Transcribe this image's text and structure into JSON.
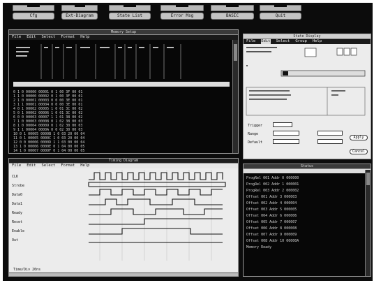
{
  "top_buttons": [
    "Cfg",
    "Ext-Diagram",
    "State List",
    "Error Msg",
    "BASIC",
    "Quit"
  ],
  "listing_window": {
    "title": "Memory Setup",
    "menu": [
      "File",
      "Edit",
      "Select",
      "Format",
      "Help"
    ],
    "rows": [
      "     0   1  0  00000  00001  0  1  00  3F  00  01",
      "     1   1  0  00000  00002  0  1  00  3F  00  01",
      "     2   1  0  00001  00003  0  0  00  3E  00  01",
      "     3   1  1  00001  00004  0  0  00  3E  00  01",
      "     4   0  1  00002  00005  1  0  01  3C  00  02",
      "     5   0  1  00002  00006  1  0  01  3C  00  02",
      "     6   0  0  00003  00007  1  1  01  38  00  02",
      "     7   1  0  00003  00008  0  1  02  38  00  03",
      "     8   1  0  00004  00009  0  1  02  30  00  03",
      "     9   1  1  00004  0000A  0  0  02  30  00  03",
      "    10   0  1  00005  0000B  1  0  03  20  00  04",
      "    11   0  1  00005  0000C  1  0  03  20  00  04",
      "    12   0  0  00006  0000D  1  1  03  00  00  04",
      "    13   1  0  00006  0000E  0  1  04  00  00  05",
      "    14   1  0  00007  0000F  0  1  04  00  00  05"
    ]
  },
  "state_window": {
    "title": "State Display",
    "menu": [
      "File",
      "Edit",
      "Select",
      "Group",
      "Help"
    ],
    "fields": {
      "trigger": "Trigger",
      "range": "Range",
      "default": "Default"
    },
    "buttons": [
      "Apply",
      "Cancel"
    ]
  },
  "timing_window": {
    "title": "Timing Diagram",
    "menu": [
      "File",
      "Edit",
      "Select",
      "Format",
      "Help"
    ],
    "signals": [
      "CLK",
      "Strobe",
      "Data0",
      "Data1",
      "Ready",
      "Reset",
      "Enable",
      "Out"
    ],
    "footer": "Time/Div 20ns"
  },
  "status_window": {
    "title": "Status",
    "rows": [
      "ProgRel  001   Addr  0  000000",
      "ProgRel  002   Addr  1  000001",
      "ProgRel  003   Addr  2  000002",
      "Offset   001   Addr  3  000003",
      "Offset   002   Addr  4  000004",
      "Offset   003   Addr  5  000005",
      "Offset   004   Addr  6  000006",
      "Offset   005   Addr  7  000007",
      "Offset   006   Addr  8  000008",
      "Offset   007   Addr  9  000009",
      "Offset   008   Addr 10  00000A",
      "Memory  Ready"
    ]
  },
  "colors": {
    "screen": "#0c0c0c",
    "panel_light": "#ececec",
    "button": "#c4c4c4"
  }
}
